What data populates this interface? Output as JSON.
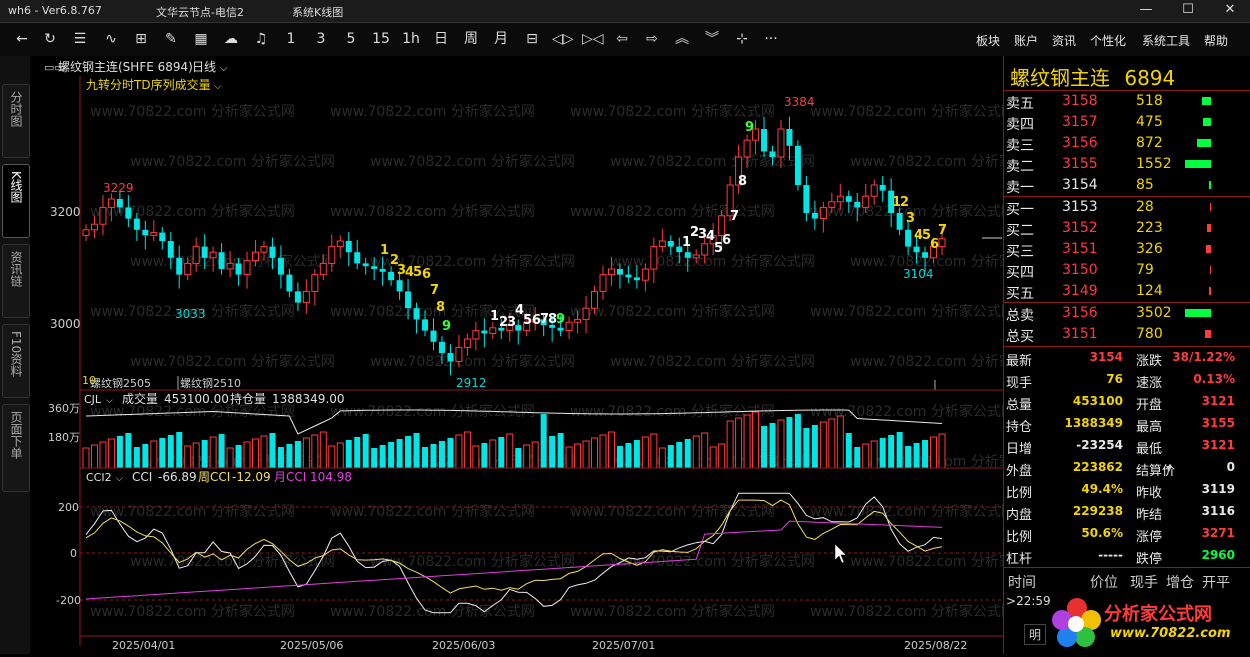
{
  "titlebar": {
    "app": "wh6 - Ver6.8.767",
    "server": "文华云节点-电信2",
    "mode": "系统K线图",
    "minimize": "—",
    "maximize": "☐",
    "close": "✕"
  },
  "toolbar": {
    "periods": [
      "1",
      "3",
      "5",
      "15",
      "1h",
      "日",
      "周",
      "月"
    ],
    "menus": [
      "板块",
      "账户",
      "资讯",
      "个性化",
      "系统工具",
      "帮助"
    ],
    "more": "···"
  },
  "left_tabs": [
    "分时图",
    "K线图",
    "资讯链",
    "F10资料",
    "页面下单"
  ],
  "chart_header": {
    "symbol": "螺纹钢主连(SHFE 6894)",
    "period": "日线",
    "indicator_name": "九转分时TD序列成交量",
    "watermark": "www.70822.com 分析家公式网"
  },
  "chart_data": {
    "type": "candlestick",
    "price_ticks": [
      3200,
      3000
    ],
    "date_ticks": [
      "2025/04/01",
      "2025/05/06",
      "2025/06/03",
      "2025/07/01",
      "2025/08/22"
    ],
    "annotations": {
      "high_1": "3229",
      "low_1": "3033",
      "low_2": "2912",
      "high_2": "3384",
      "low_3": "3104"
    },
    "contract_labels": [
      "螺纹钢2505",
      "螺纹钢2510"
    ],
    "contract_prefix": "10"
  },
  "volume_panel": {
    "name": "CJL",
    "vol_label": "成交量",
    "vol_value": "453100.00",
    "oi_label": "持仓量",
    "oi_value": "1388349.00",
    "ticks": [
      "360万",
      "180万"
    ]
  },
  "cci_panel": {
    "name": "CCI2",
    "cci_label": "CCI",
    "cci_value": "-66.89",
    "week_label": "周CCI",
    "week_value": "-12.09",
    "month_label": "月CCI",
    "month_value": "104.98",
    "ticks": [
      "200",
      "0",
      "-200"
    ]
  },
  "quote": {
    "title": "螺纹钢主连",
    "code": "6894",
    "asks": [
      {
        "label": "卖五",
        "price": "3158",
        "vol": "518",
        "bar": 0.33
      },
      {
        "label": "卖四",
        "price": "3157",
        "vol": "475",
        "bar": 0.3
      },
      {
        "label": "卖三",
        "price": "3156",
        "vol": "872",
        "bar": 0.55
      },
      {
        "label": "卖二",
        "price": "3155",
        "vol": "1552",
        "bar": 1.0
      },
      {
        "label": "卖一",
        "price": "3154",
        "vol": "85",
        "bar": 0.06
      }
    ],
    "bids": [
      {
        "label": "买一",
        "price": "3153",
        "vol": "28",
        "bar": 0.02
      },
      {
        "label": "买二",
        "price": "3152",
        "vol": "223",
        "bar": 0.14
      },
      {
        "label": "买三",
        "price": "3151",
        "vol": "326",
        "bar": 0.21
      },
      {
        "label": "买四",
        "price": "3150",
        "vol": "79",
        "bar": 0.05
      },
      {
        "label": "买五",
        "price": "3149",
        "vol": "124",
        "bar": 0.08
      }
    ],
    "totals": [
      {
        "label": "总卖",
        "price": "3156",
        "vol": "3502",
        "bar": 1.0
      },
      {
        "label": "总买",
        "price": "3151",
        "vol": "780",
        "bar": 0.22
      }
    ],
    "stats": [
      {
        "l1": "最新",
        "v1": "3154",
        "l2": "涨跌",
        "v2": "38/1.22%"
      },
      {
        "l1": "现手",
        "v1": "76",
        "l2": "速涨",
        "v2": "0.13%"
      },
      {
        "l1": "总量",
        "v1": "453100",
        "l2": "开盘",
        "v2": "3121"
      },
      {
        "l1": "持仓",
        "v1": "1388349",
        "l2": "最高",
        "v2": "3155"
      },
      {
        "l1": "日增",
        "v1": "-23254",
        "l2": "最低",
        "v2": "3121"
      },
      {
        "l1": "外盘",
        "v1": "223862",
        "l2": "结算价",
        "v2": "0"
      },
      {
        "l1": "比例",
        "v1": "49.4%",
        "l2": "昨收",
        "v2": "3119"
      },
      {
        "l1": "内盘",
        "v1": "229238",
        "l2": "昨结",
        "v2": "3116"
      },
      {
        "l1": "比例",
        "v1": "50.6%",
        "l2": "涨停",
        "v2": "3271"
      },
      {
        "l1": "杠杆",
        "v1": "-----",
        "l2": "跌停",
        "v2": "2960"
      }
    ],
    "tick_header": [
      "时间",
      "价位",
      "现手",
      "增仓",
      "开平"
    ],
    "tick_time": "22:59",
    "logo_text": "分析家公式网",
    "logo_url": "www.70822.com",
    "bottom_tab": "明"
  }
}
